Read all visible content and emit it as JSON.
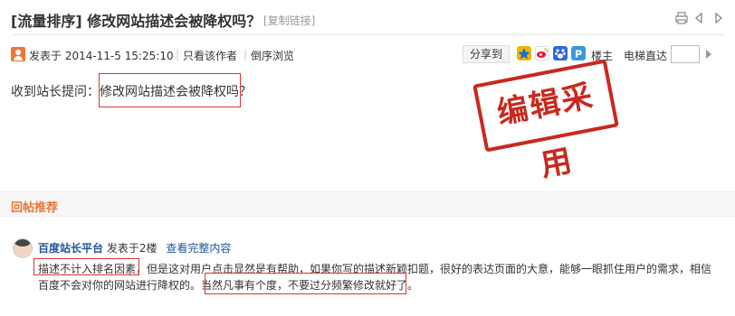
{
  "title": {
    "text": "[流量排序] 修改网站描述会被降权吗？",
    "copy_link": "[复制链接]"
  },
  "title_icons": [
    "print-icon",
    "prev-thread-icon",
    "next-thread-icon"
  ],
  "meta": {
    "posted": "发表于 2014-11-5 15:25:10",
    "sep": "|",
    "only_author": "只看该作者",
    "reverse": "倒序浏览",
    "share": "分享到",
    "share_icons": [
      "qzone-icon",
      "weibo-icon",
      "baidu-icon",
      "pengyou-icon"
    ],
    "floor_master": "楼主",
    "elevator": "电梯直达"
  },
  "post": {
    "body": "收到站长提问：修改网站描述会被降权吗？"
  },
  "stamp": {
    "text": "编辑采用"
  },
  "recommend": {
    "title": "回帖推荐"
  },
  "reply": {
    "author": "百度站长平台",
    "floor": "发表于2楼",
    "view_full": "查看完整内容",
    "line1": "描述不计入排名因素，但是这对用户点击显然是有帮助，如果你写的描述新颖扣题，很好的表达页面的大意，能够一眼抓住用户的需求，相信",
    "line2": "百度不会对你的网站进行降权的。当然凡事有个度，不要过分频繁修改就好了。"
  },
  "colors": {
    "accent_orange": "#e8763a",
    "stamp_red": "#c8291f",
    "link_blue": "#225599",
    "highlight_red": "#dd3333"
  }
}
